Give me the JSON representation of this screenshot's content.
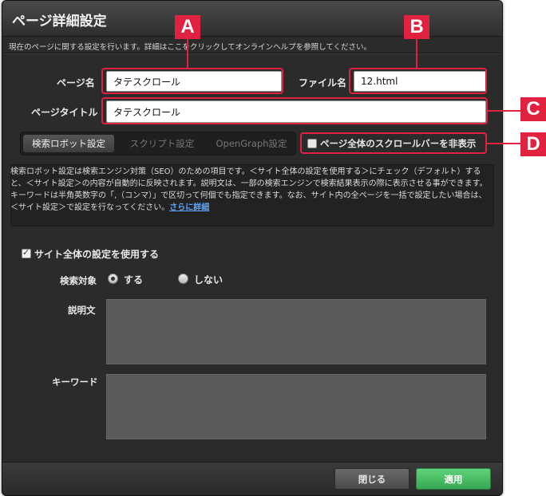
{
  "dialog": {
    "title": "ページ詳細設定",
    "subtitle": "現在のページに関する設定を行います。詳細はここをクリックしてオンラインヘルプを参照してください。"
  },
  "fields": {
    "page_name_label": "ページ名",
    "page_name_value": "タテスクロール",
    "file_name_label": "ファイル名",
    "file_name_value": "12.html",
    "page_title_label": "ページタイトル",
    "page_title_value": "タテスクロール"
  },
  "tabs": [
    {
      "label": "検索ロボット設定",
      "active": true
    },
    {
      "label": "スクリプト設定",
      "active": false
    },
    {
      "label": "OpenGraph設定",
      "active": false
    }
  ],
  "hide_scrollbar": {
    "label": "ページ全体のスクロールバーを非表示",
    "checked": false
  },
  "info": {
    "text": "検索ロボット設定は検索エンジン対策（SEO）のための項目です。＜サイト全体の設定を使用する＞にチェック（デフォルト）すると、＜サイト設定＞の内容が自動的に反映されます。説明文は、一部の検索エンジンで検索結果表示の際に表示させる事ができます。キーワードは半角英数字の「,（コンマ）」で区切って何個でも指定できます。なお、サイト内の全ページを一括で設定したい場合は、＜サイト設定＞で設定を行なってください。",
    "link": "さらに詳細"
  },
  "site_settings": {
    "use_site_label": "サイト全体の設定を使用する",
    "use_site_checked": true,
    "search_target_label": "検索対象",
    "radio_yes": "する",
    "radio_no": "しない",
    "description_label": "説明文",
    "keywords_label": "キーワード"
  },
  "buttons": {
    "close": "閉じる",
    "apply": "適用"
  },
  "callouts": [
    "A",
    "B",
    "C",
    "D"
  ],
  "colors": {
    "highlight": "#e0213f",
    "apply_button": "#37a853",
    "link": "#5ea9ff"
  }
}
